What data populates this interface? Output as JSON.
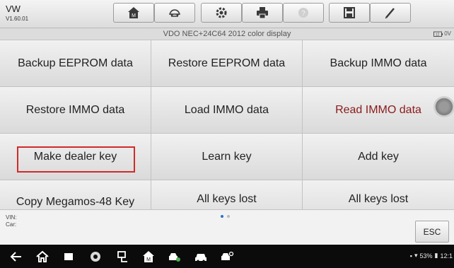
{
  "app": {
    "title": "VW",
    "version": "V1.60.01"
  },
  "toolbar": {
    "buttons": [
      {
        "name": "home-icon"
      },
      {
        "name": "vehicle-swap-icon"
      },
      {
        "name": "settings-icon"
      },
      {
        "name": "print-icon"
      },
      {
        "name": "help-icon"
      },
      {
        "name": "save-icon"
      },
      {
        "name": "edit-icon"
      }
    ]
  },
  "header": {
    "subtitle": "VDO NEC+24C64 2012 color display",
    "battery": "0V"
  },
  "functions": [
    {
      "label": "Backup EEPROM data"
    },
    {
      "label": "Restore EEPROM data"
    },
    {
      "label": "Backup IMMO data"
    },
    {
      "label": "Restore IMMO data"
    },
    {
      "label": "Load IMMO data"
    },
    {
      "label": "Read IMMO data"
    },
    {
      "label": "Make dealer key"
    },
    {
      "label": "Learn key"
    },
    {
      "label": "Add key"
    },
    {
      "label": "Copy Megamos-48 Key"
    },
    {
      "label": "All keys lost"
    },
    {
      "label": "All keys lost"
    }
  ],
  "info": {
    "vin_label": "VIN:",
    "car_label": "Car:",
    "esc_label": "ESC",
    "page_count": 2,
    "current_page": 1
  },
  "status": {
    "battery_percent": "53%",
    "time": "12:1"
  },
  "colors": {
    "highlight": "#d22a2a",
    "red_text": "#8b1a1a",
    "page_dot_active": "#2f6fcf"
  }
}
